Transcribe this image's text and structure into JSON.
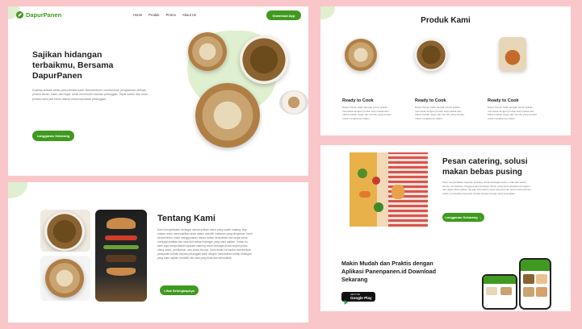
{
  "nav": {
    "brand": "DapurPanen",
    "links": [
      "Home",
      "Produk",
      "Promo",
      "About Us"
    ],
    "cta": "Download App"
  },
  "hero": {
    "title": "Sajikan hidangan terbaikmu, Bersama DapurPanen",
    "body": "Kualitas terbaik selalu jadi prioritas kami. Berkomitmen memberikan pengalaman terbaik, produk aman, halal, dan legal, serta memenuhi standar pelanggan. Tepat waktu dan mutu produk kami jadi fokus utama untuk kepuasan pelanggan.",
    "cta": "Langganan Sekarang"
  },
  "about": {
    "title": "Tentang Kami",
    "body": "Kami menyediakan berbagai macam pilihan menu yang sudah matang, siap makan untuk memudahkan anda dalam memilih makanan yang diinginkan. Kami berkomitmen untuk menggunakan bahan-bahan berkualitas dan segar untuk menjaga kualitas dan rasa dari setiap hidangan yang kami sajikan. Selain itu, kami juga menyediakan layanan catering untuk berbagai acara seperti pesta ulang tahun, pernikahan, dan acara lainnya. Kami selalu berusaha memberikan pelayanan terbaik kepada pelanggan kami dengan memastikan setiap hidangan yang kami sajikan memiliki cita rasa yang lezat dan berkualitas.",
    "cta": "Lihat Selengkapnya"
  },
  "products": {
    "title": "Produk Kami",
    "items": [
      {
        "name": "Ready to Cook",
        "desc": "Dapur Panen hadir dengan solusi praktis memasak dengan produk siap masak dan bahan-bahan segar dan bumbu yang terukur untuk menghemat waktu."
      },
      {
        "name": "Ready to Cook",
        "desc": "Dapur Panen hadir dengan solusi praktis memasak dengan produk siap masak dan bahan-bahan segar dan bumbu yang terukur untuk menghemat waktu."
      },
      {
        "name": "Ready to Cook",
        "desc": "Dapur Panen hadir dengan solusi praktis memasak dengan produk siap masak dan bahan-bahan segar dan bumbu yang terukur untuk menghemat waktu."
      }
    ]
  },
  "catering": {
    "title": "Pesan catering, solusi makan bebas pusing",
    "body": "Kami menyediakan layanan catering untuk berbagai acara, mulai dari acara kantor, pernikahan, hingga acara keluarga. Menu yang kami tawarkan beragam dan dapat disesuaikan dengan kebutuhan serta selera Anda. Kami berkomitmen untuk memberikan layanan terbaik dengan harga yang terjangkau.",
    "cta": "Langganan Sekarang →"
  },
  "app": {
    "title": "Makin Mudah dan Praktis dengan Aplikasi Panenpanen.id Download Sekarang",
    "store_small": "GET IT ON",
    "store_big": "Google Play"
  },
  "colors": {
    "accent": "#3f9a1f",
    "background": "#f9c7c9",
    "blob": "#dff0d0"
  }
}
